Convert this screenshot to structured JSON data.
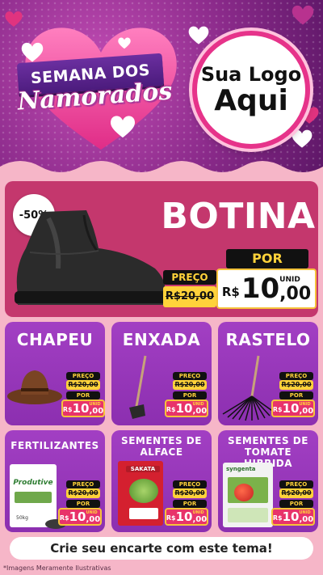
{
  "banner": {
    "ribbon_text": "SEMANA DOS",
    "script_title": "Namorados",
    "logo_line1": "Sua Logo",
    "logo_line2": "Aqui"
  },
  "featured": {
    "discount": "-50%",
    "title": "BOTINA",
    "preco_label": "PREÇO",
    "old_price": "R$20,00",
    "por_label": "POR",
    "new_currency": "R$",
    "new_integer": "10",
    "new_cents": ",00",
    "unit": "UNID"
  },
  "products": [
    {
      "title": "CHAPEU",
      "preco_label": "PREÇO",
      "old_price": "R$20,00",
      "por_label": "POR",
      "new_currency": "R$",
      "new_integer": "10",
      "new_cents": ",00",
      "unit": "UNID"
    },
    {
      "title": "ENXADA",
      "preco_label": "PREÇO",
      "old_price": "R$20,00",
      "por_label": "POR",
      "new_currency": "R$",
      "new_integer": "10",
      "new_cents": ",00",
      "unit": "UNID"
    },
    {
      "title": "RASTELO",
      "preco_label": "PREÇO",
      "old_price": "R$20,00",
      "por_label": "POR",
      "new_currency": "R$",
      "new_integer": "10",
      "new_cents": ",00",
      "unit": "UNID"
    },
    {
      "title": "FERTILIZANTES",
      "preco_label": "PREÇO",
      "old_price": "R$20,00",
      "por_label": "POR",
      "new_currency": "R$",
      "new_integer": "10",
      "new_cents": ",00",
      "unit": "UNID"
    },
    {
      "title": "SEMENTES DE ALFACE",
      "preco_label": "PREÇO",
      "old_price": "R$20,00",
      "por_label": "POR",
      "new_currency": "R$",
      "new_integer": "10",
      "new_cents": ",00",
      "unit": "UNID"
    },
    {
      "title": "SEMENTES DE TOMATE HIBRIDA",
      "preco_label": "PREÇO",
      "old_price": "R$20,00",
      "por_label": "POR",
      "new_currency": "R$",
      "new_integer": "10",
      "new_cents": ",00",
      "unit": "UNID"
    }
  ],
  "product_images": {
    "fertilizer_brand": "Produtive",
    "fertilizer_weight": "50kg",
    "alface_brand": "SAKATA",
    "tomate_brand": "syngenta"
  },
  "footer": {
    "cta": "Crie seu encarte com este tema!",
    "disclaimer": "*Imagens Meramente Ilustrativas"
  },
  "colors": {
    "banner_purple": "#8a2a8a",
    "card_purple": "#9b38bd",
    "featured_red": "#c4376d",
    "price_yellow": "#ffd23a",
    "price_pink": "#e8336a",
    "background_pink": "#f6b6c8"
  },
  "icons": [
    "heart-icon",
    "logo-placeholder-circle"
  ]
}
